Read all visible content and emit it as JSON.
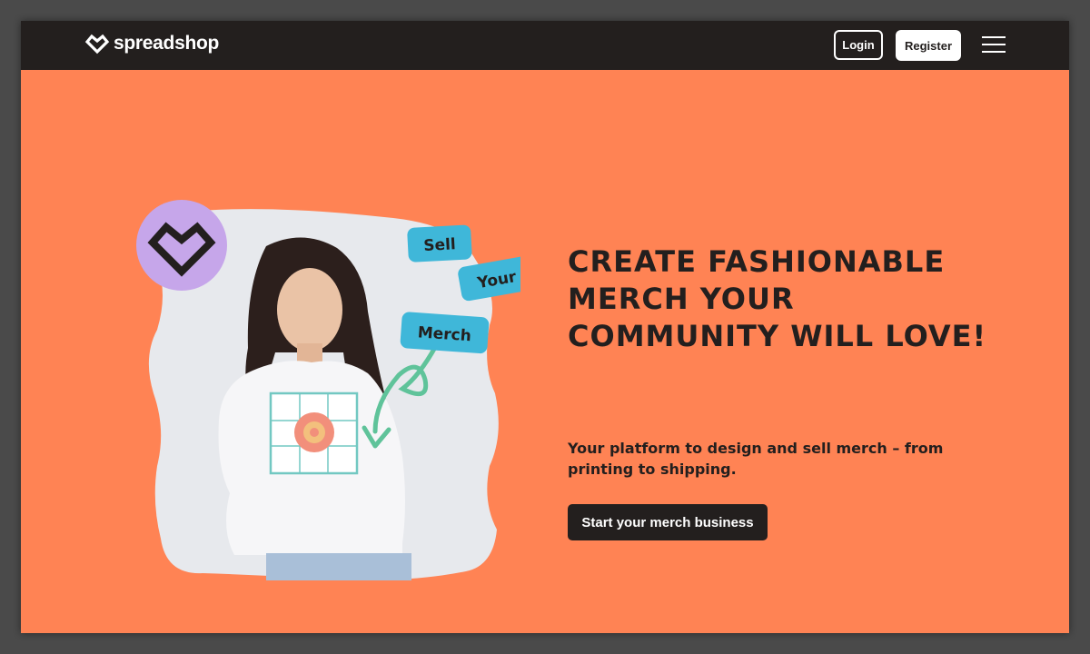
{
  "brand": {
    "name": "spreadshop",
    "colors": {
      "accent": "#ff8354",
      "dark": "#231f1e",
      "lavender": "#c6a6ea",
      "tag": "#3fb7d9",
      "arrow": "#5fc39a"
    }
  },
  "nav": {
    "login_label": "Login",
    "register_label": "Register",
    "menu_icon": "hamburger-menu-icon"
  },
  "hero": {
    "headline": "CREATE FASHIONABLE MERCH YOUR COMMUNITY WILL LOVE!",
    "subheadline": "Your platform to design and sell merch – from printing to shipping.",
    "cta_label": "Start your merch business",
    "tags": [
      "Sell",
      "Your",
      "Merch"
    ],
    "badge_icon": "heart-logo-icon"
  }
}
